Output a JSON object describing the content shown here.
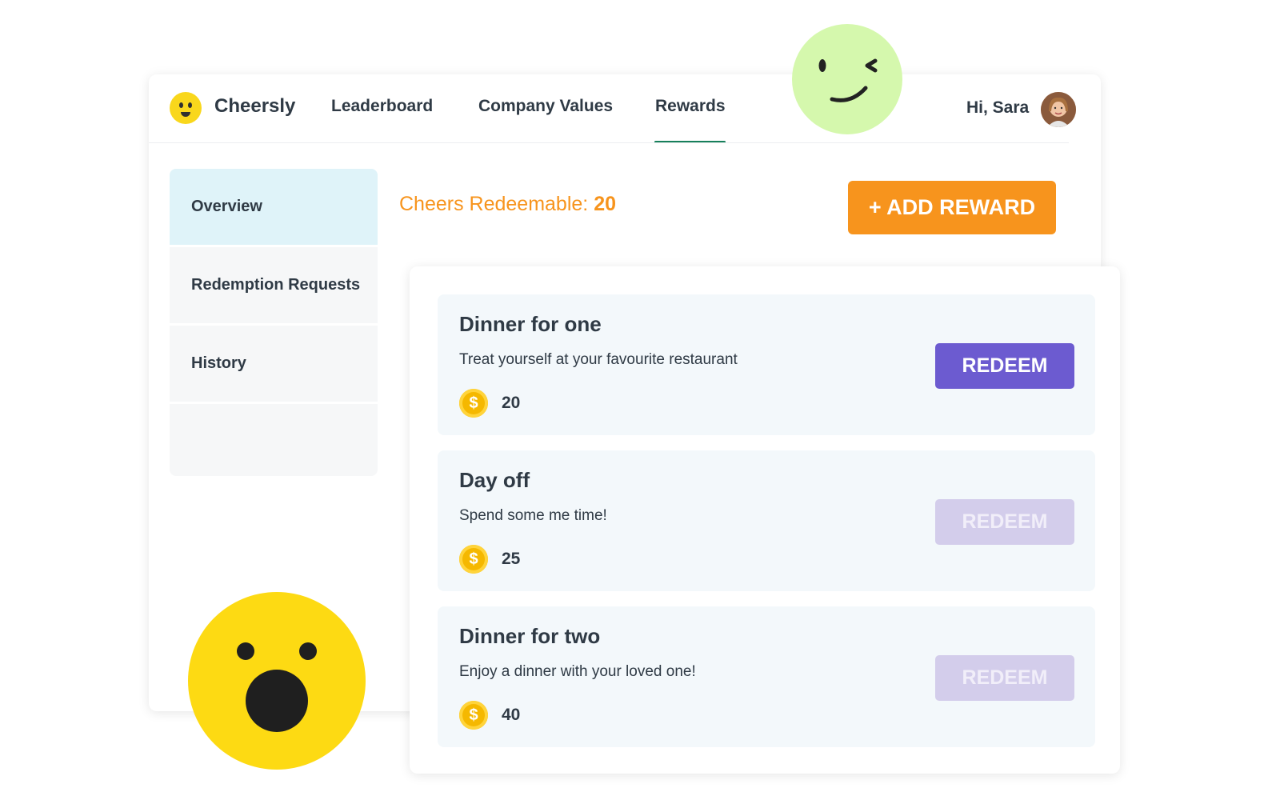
{
  "app": {
    "brand": "Cheersly"
  },
  "nav": {
    "tabs": [
      {
        "label": "Leaderboard"
      },
      {
        "label": "Company Values"
      },
      {
        "label": "Rewards",
        "active": true
      }
    ],
    "greeting": "Hi, Sara"
  },
  "sidebar": {
    "items": [
      {
        "label": "Overview",
        "active": true
      },
      {
        "label": "Redemption Requests"
      },
      {
        "label": "History"
      }
    ]
  },
  "summary": {
    "label": "Cheers Redeemable: ",
    "value": "20"
  },
  "add_reward_label": "+ ADD REWARD",
  "rewards": [
    {
      "title": "Dinner for one",
      "description": "Treat yourself at your favourite restaurant",
      "cost": "20",
      "button": "REDEEM",
      "enabled": true
    },
    {
      "title": "Day off",
      "description": "Spend some me time!",
      "cost": "25",
      "button": "REDEEM",
      "enabled": false
    },
    {
      "title": "Dinner for two",
      "description": "Enjoy a dinner with your loved one!",
      "cost": "40",
      "button": "REDEEM",
      "enabled": false
    }
  ],
  "icons": {
    "coin": "coin-icon",
    "logo": "smiley-logo-icon",
    "wink": "winking-face-icon",
    "shock": "surprised-face-icon"
  },
  "colors": {
    "accent_orange": "#f7941d",
    "active_tab_underline": "#17805b",
    "redeem_enabled": "#6c5bd0",
    "redeem_disabled": "#d3cdeb",
    "sidebar_active": "#dff3f9",
    "card_bg": "#f3f8fb"
  }
}
